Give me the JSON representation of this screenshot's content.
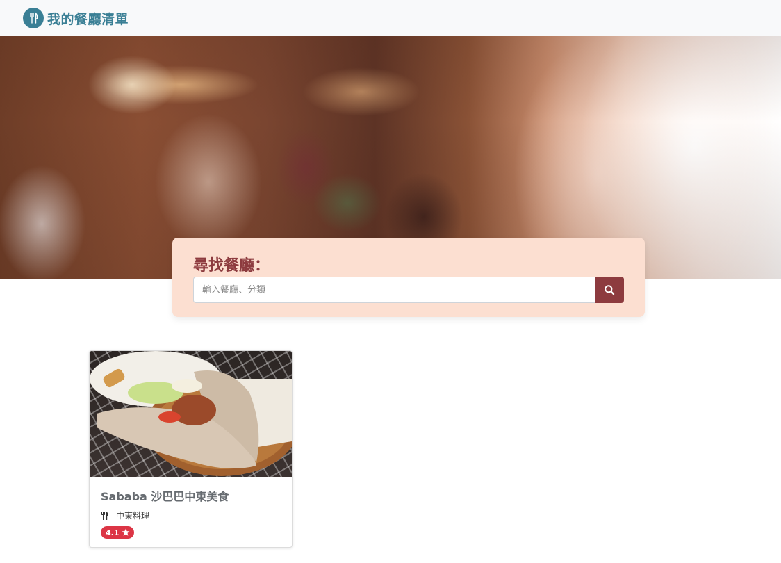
{
  "navbar": {
    "brand_title": "我的餐廳清單",
    "brand_color": "#3a7f95"
  },
  "hero": {
    "image_description_icon": "restaurant-interior-blurred-photo"
  },
  "search": {
    "title": "尋找餐廳：",
    "placeholder": "輸入餐廳、分類",
    "value": "",
    "button_icon": "search-icon",
    "accent_color": "#8d3b3f",
    "panel_color": "#fcdfd1"
  },
  "restaurants": [
    {
      "name": "Sababa 沙巴巴中東美食",
      "category": "中東料理",
      "category_icon": "utensils-icon",
      "rating": "4.1",
      "rating_icon": "star-icon",
      "rating_color": "#dc3545"
    }
  ]
}
